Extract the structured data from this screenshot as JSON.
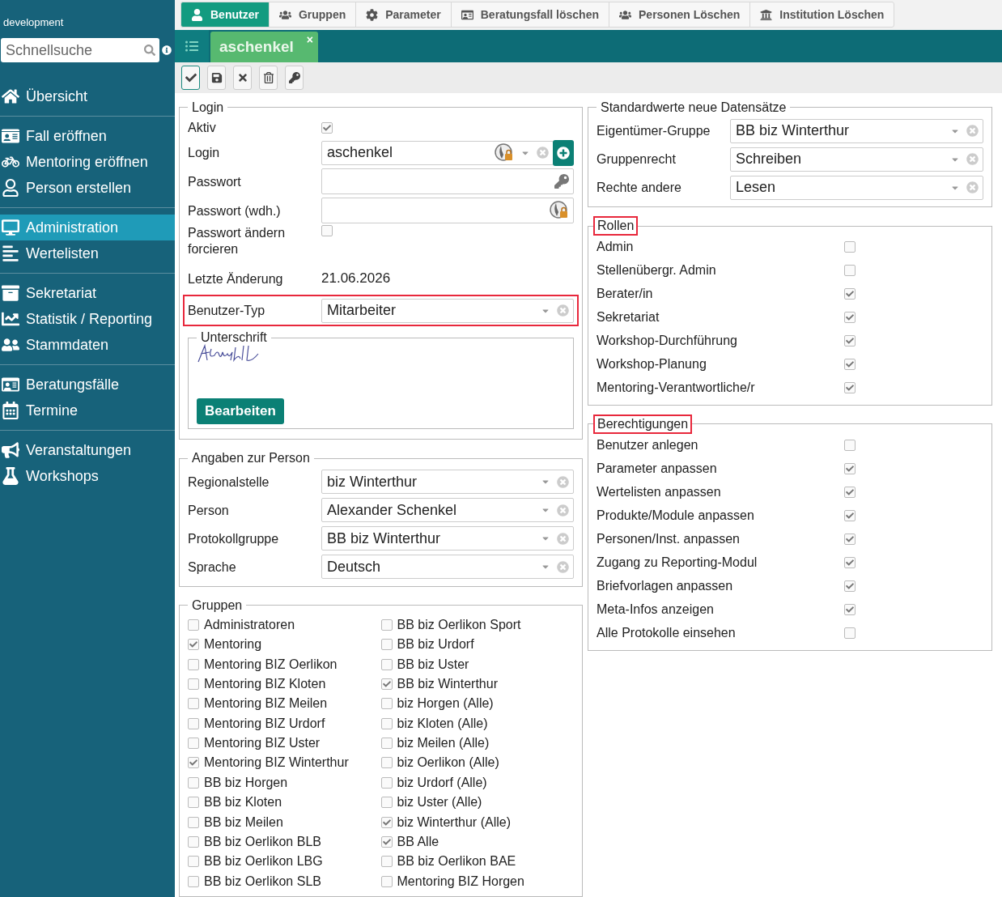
{
  "sidebar": {
    "environment": "development",
    "search": {
      "placeholder": "Schnellsuche"
    },
    "groups": [
      [
        {
          "label": "Übersicht",
          "selected": false
        }
      ],
      [
        {
          "label": "Fall eröffnen",
          "selected": false
        },
        {
          "label": "Mentoring eröffnen",
          "selected": false
        },
        {
          "label": "Person erstellen",
          "selected": false
        }
      ],
      [
        {
          "label": "Administration",
          "selected": true
        },
        {
          "label": "Wertelisten",
          "selected": false
        }
      ],
      [
        {
          "label": "Sekretariat",
          "selected": false
        },
        {
          "label": "Statistik / Reporting",
          "selected": false
        },
        {
          "label": "Stammdaten",
          "selected": false
        }
      ],
      [
        {
          "label": "Beratungsfälle",
          "selected": false
        },
        {
          "label": "Termine",
          "selected": false
        }
      ],
      [
        {
          "label": "Veranstaltungen",
          "selected": false
        },
        {
          "label": "Workshops",
          "selected": false
        }
      ]
    ]
  },
  "top_tabs": [
    {
      "label": "Benutzer",
      "selected": true
    },
    {
      "label": "Gruppen",
      "selected": false
    },
    {
      "label": "Parameter",
      "selected": false
    },
    {
      "label": "Beratungsfall löschen",
      "selected": false
    },
    {
      "label": "Personen Löschen",
      "selected": false
    },
    {
      "label": "Institution Löschen",
      "selected": false
    }
  ],
  "document_tabs": [
    {
      "label": "aschenkel",
      "close": "×",
      "selected": true
    }
  ],
  "login": {
    "title": "Login",
    "highlighted": false,
    "fields": [
      {
        "kind": "checkbox",
        "label": "Aktiv",
        "checked": true,
        "highlighted": false
      },
      {
        "kind": "login",
        "label": "Login",
        "value": "aschenkel",
        "highlighted": false
      },
      {
        "kind": "password",
        "label": "Passwort",
        "highlighted": false
      },
      {
        "kind": "password_repeat",
        "label": "Passwort (wdh.)",
        "highlighted": false
      },
      {
        "kind": "checkbox",
        "label": "Passwort ändern forcieren",
        "checked": false,
        "highlighted": false
      },
      {
        "kind": "text",
        "label": "Letzte Änderung",
        "value": "21.06.2026",
        "highlighted": false
      },
      {
        "kind": "select",
        "label": "Benutzer-Typ",
        "value": "Mitarbeiter",
        "highlighted": true
      }
    ],
    "signature": {
      "title": "Unterschrift",
      "button": "Bearbeiten"
    }
  },
  "person": {
    "title": "Angaben zur Person",
    "highlighted": false,
    "fields": [
      {
        "kind": "select",
        "label": "Regionalstelle",
        "value": "biz Winterthur",
        "highlighted": false
      },
      {
        "kind": "select",
        "label": "Person",
        "value": "Alexander Schenkel",
        "highlighted": false
      },
      {
        "kind": "select",
        "label": "Protokollgruppe",
        "value": "BB biz Winterthur",
        "highlighted": false
      },
      {
        "kind": "select",
        "label": "Sprache",
        "value": "Deutsch",
        "highlighted": false
      }
    ]
  },
  "groups": {
    "title": "Gruppen",
    "highlighted": false,
    "columns": [
      [
        {
          "label": "Administratoren",
          "checked": false
        },
        {
          "label": "Mentoring",
          "checked": true
        },
        {
          "label": "Mentoring BIZ Oerlikon",
          "checked": false
        },
        {
          "label": "Mentoring BIZ Kloten",
          "checked": false
        },
        {
          "label": "Mentoring BIZ Meilen",
          "checked": false
        },
        {
          "label": "Mentoring BIZ Urdorf",
          "checked": false
        },
        {
          "label": "Mentoring BIZ Uster",
          "checked": false
        },
        {
          "label": "Mentoring BIZ Winterthur",
          "checked": true
        },
        {
          "label": "BB biz Horgen",
          "checked": false
        },
        {
          "label": "BB biz Kloten",
          "checked": false
        },
        {
          "label": "BB biz Meilen",
          "checked": false
        },
        {
          "label": "BB biz Oerlikon BLB",
          "checked": false
        },
        {
          "label": "BB biz Oerlikon LBG",
          "checked": false
        },
        {
          "label": "BB biz Oerlikon SLB",
          "checked": false
        }
      ],
      [
        {
          "label": "BB biz Oerlikon Sport",
          "checked": false
        },
        {
          "label": "BB biz Urdorf",
          "checked": false
        },
        {
          "label": "BB biz Uster",
          "checked": false
        },
        {
          "label": "BB biz Winterthur",
          "checked": true
        },
        {
          "label": "biz Horgen (Alle)",
          "checked": false
        },
        {
          "label": "biz Kloten (Alle)",
          "checked": false
        },
        {
          "label": "biz Meilen (Alle)",
          "checked": false
        },
        {
          "label": "biz Oerlikon (Alle)",
          "checked": false
        },
        {
          "label": "biz Urdorf (Alle)",
          "checked": false
        },
        {
          "label": "biz Uster (Alle)",
          "checked": false
        },
        {
          "label": "biz Winterthur (Alle)",
          "checked": true
        },
        {
          "label": "BB Alle",
          "checked": true
        },
        {
          "label": "BB biz Oerlikon BAE",
          "checked": false
        },
        {
          "label": "Mentoring BIZ Horgen",
          "checked": false
        }
      ]
    ]
  },
  "defaults": {
    "title": "Standardwerte neue Datensätze",
    "highlighted": false,
    "fields": [
      {
        "kind": "select",
        "label": "Eigentümer-Gruppe",
        "value": "BB biz Winterthur",
        "highlighted": false
      },
      {
        "kind": "select",
        "label": "Gruppenrecht",
        "value": "Schreiben",
        "highlighted": false
      },
      {
        "kind": "select",
        "label": "Rechte andere",
        "value": "Lesen",
        "highlighted": false
      }
    ]
  },
  "roles": {
    "title": "Rollen",
    "highlighted": true,
    "items": [
      {
        "label": "Admin",
        "checked": false
      },
      {
        "label": "Stellenübergr. Admin",
        "checked": false
      },
      {
        "label": "Berater/in",
        "checked": true
      },
      {
        "label": "Sekretariat",
        "checked": true
      },
      {
        "label": "Workshop-Durchführung",
        "checked": true
      },
      {
        "label": "Workshop-Planung",
        "checked": true
      },
      {
        "label": "Mentoring-Verantwortliche/r",
        "checked": true
      }
    ]
  },
  "permissions": {
    "title": "Berechtigungen",
    "highlighted": true,
    "items": [
      {
        "label": "Benutzer anlegen",
        "checked": false
      },
      {
        "label": "Parameter anpassen",
        "checked": true
      },
      {
        "label": "Wertelisten anpassen",
        "checked": true
      },
      {
        "label": "Produkte/Module anpassen",
        "checked": true
      },
      {
        "label": "Personen/Inst. anpassen",
        "checked": true
      },
      {
        "label": "Zugang zu Reporting-Modul",
        "checked": true
      },
      {
        "label": "Briefvorlagen anpassen",
        "checked": true
      },
      {
        "label": "Meta-Infos anzeigen",
        "checked": true
      },
      {
        "label": "Alle Protokolle einsehen",
        "checked": false
      }
    ]
  }
}
